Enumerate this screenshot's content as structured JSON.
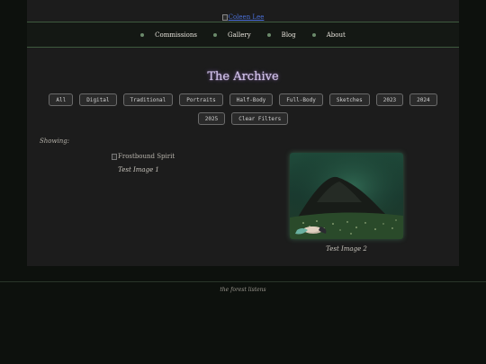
{
  "header": {
    "logo_alt": "Coleen Lee"
  },
  "nav": {
    "items": [
      {
        "label": "Commissions"
      },
      {
        "label": "Gallery"
      },
      {
        "label": "Blog"
      },
      {
        "label": "About"
      }
    ]
  },
  "main": {
    "title": "The Archive",
    "filters": [
      "All",
      "Digital",
      "Traditional",
      "Portraits",
      "Half-Body",
      "Full-Body",
      "Sketches",
      "2023",
      "2024",
      "2025"
    ],
    "clear_filters_label": "Clear Filters",
    "showing_label": "Showing:",
    "gallery": [
      {
        "alt": "Frostbound Spirit",
        "caption": "Test Image 1"
      },
      {
        "caption": "Test Image 2"
      }
    ]
  },
  "footer": {
    "text": "the forest listens"
  },
  "colors": {
    "background": "#0d110d",
    "panel": "#1c1c1c",
    "title_glow": "#7a5aa0",
    "nav_border": "#3e5a3e"
  }
}
